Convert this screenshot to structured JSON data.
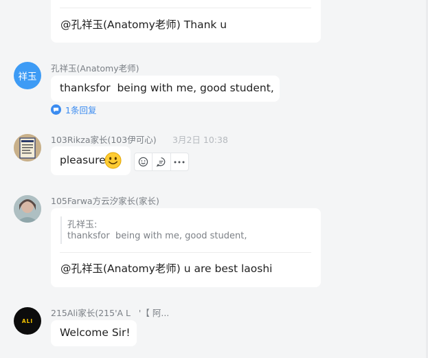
{
  "messages": [
    {
      "text": "@孔祥玉(Anatomy老师) Thank u"
    },
    {
      "sender": "孔祥玉(Anatomy老师)",
      "avatar_text": "祥玉",
      "avatar_color": "#3d9bf5",
      "text": "thanksfor  being with me, good student,",
      "reply_label": "1条回复"
    },
    {
      "sender": "103Rikza家长(103伊可心)",
      "timestamp": "3月2日 10:38",
      "text": "pleasure",
      "emoji": "smiley-emoji",
      "actions": [
        "emoji-reaction",
        "reply",
        "more"
      ]
    },
    {
      "sender": "105Farwa方云汐家长(家长)",
      "quote_name": "孔祥玉:",
      "quote_text": "thanksfor  being with me, good student,",
      "text": "@孔祥玉(Anatomy老师) u are best laoshi"
    },
    {
      "sender": "215Ali家长(215'A L   '【 阿...",
      "avatar_text": "ALI",
      "text": "Welcome Sir!"
    }
  ],
  "colors": {
    "background": "#f4f5f6",
    "bubble": "#ffffff",
    "link": "#3a8bf0"
  }
}
